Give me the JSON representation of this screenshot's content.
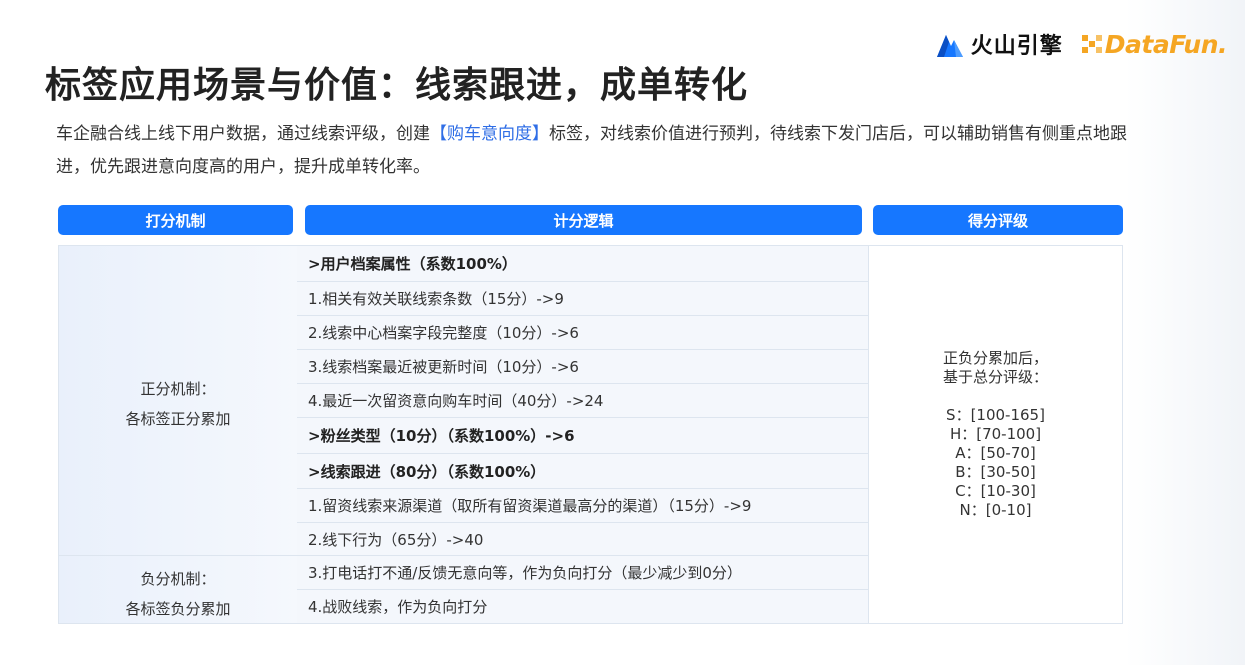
{
  "title": "标签应用场景与价值：线索跟进，成单转化",
  "logos": {
    "volcano": "火山引擎",
    "datafun": "DataFun."
  },
  "description": {
    "part1": "车企融合线上线下用户数据，通过线索评级，创建",
    "highlight": "【购车意向度】",
    "part2": "标签，对线索价值进行预判，待线索下发门店后，可以辅助销售有侧重点地跟进，优先跟进意向度高的用户，提升成单转化率。"
  },
  "headers": {
    "mechanism": "打分机制",
    "logic": "计分逻辑",
    "grade": "得分评级"
  },
  "mechanisms": {
    "positive_line1": "正分机制：",
    "positive_line2": "各标签正分累加",
    "negative_line1": "负分机制：",
    "negative_line2": "各标签负分累加"
  },
  "logic_rows": [
    {
      "text": ">用户档案属性（系数100%）",
      "bold": true
    },
    {
      "text": "1.相关有效关联线索条数（15分）->9",
      "bold": false
    },
    {
      "text": "2.线索中心档案字段完整度（10分）->6",
      "bold": false
    },
    {
      "text": "3.线索档案最近被更新时间（10分）->6",
      "bold": false
    },
    {
      "text": "4.最近一次留资意向购车时间（40分）->24",
      "bold": false
    },
    {
      "text": ">粉丝类型（10分）（系数100%）->6",
      "bold": true
    },
    {
      "text": ">线索跟进（80分）（系数100%）",
      "bold": true
    },
    {
      "text": "1.留资线索来源渠道（取所有留资渠道最高分的渠道）（15分）->9",
      "bold": false
    },
    {
      "text": "2.线下行为（65分）->40",
      "bold": false
    },
    {
      "text": "3.打电话打不通/反馈无意向等，作为负向打分（最少减少到0分）",
      "bold": false
    },
    {
      "text": "4.战败线索，作为负向打分",
      "bold": false
    }
  ],
  "grade": {
    "intro_line1": "正负分累加后，",
    "intro_line2": "基于总分评级：",
    "levels": [
      "S：[100-165]",
      "H：[70-100]",
      "A：[50-70]",
      "B：[30-50]",
      "C：[10-30]",
      "N：[0-10]"
    ]
  },
  "colors": {
    "accent": "#1677ff",
    "highlight": "#2f6ee6",
    "datafun": "#f5a623"
  }
}
